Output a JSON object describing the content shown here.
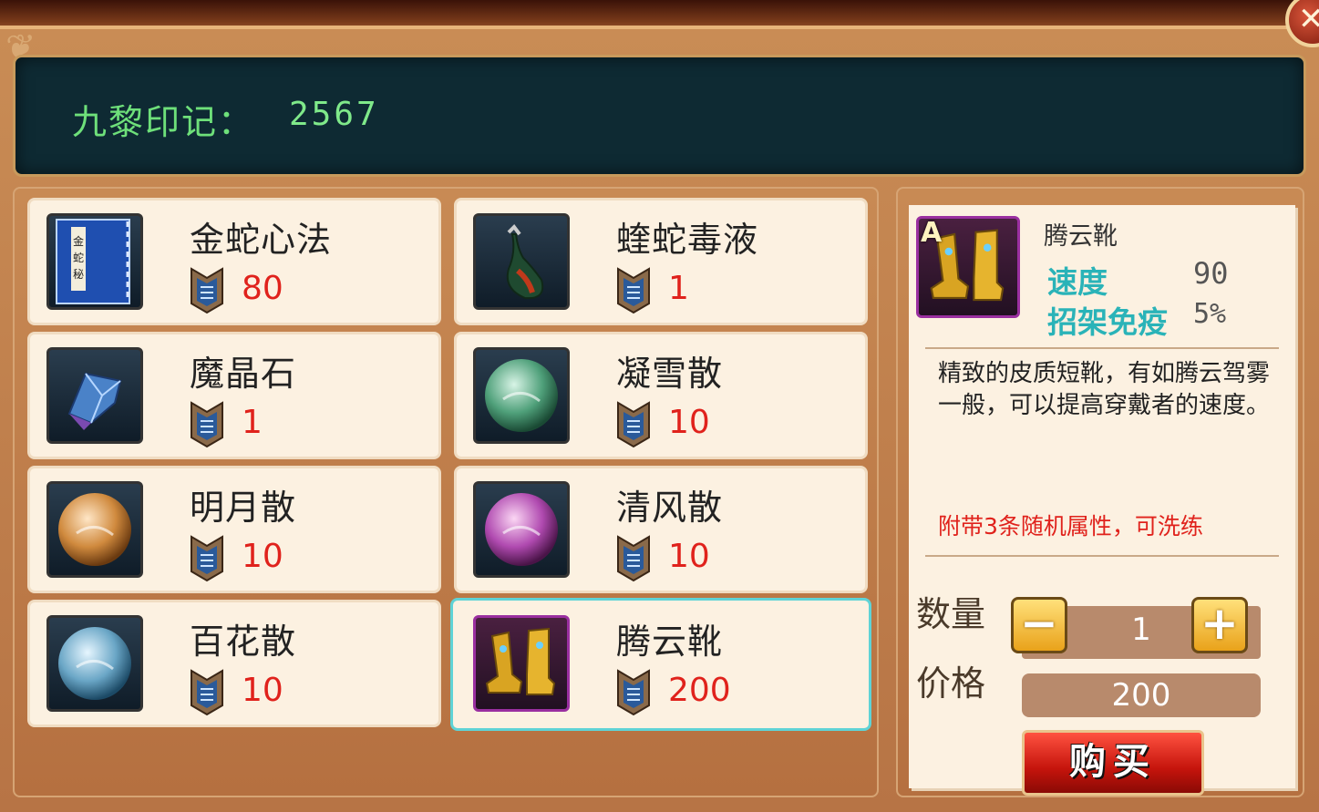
{
  "currency": {
    "label": "九黎印记：",
    "value": "2567"
  },
  "items": [
    {
      "name": "金蛇心法",
      "price": "80"
    },
    {
      "name": "蝰蛇毒液",
      "price": "1"
    },
    {
      "name": "魔晶石",
      "price": "1"
    },
    {
      "name": "凝雪散",
      "price": "10"
    },
    {
      "name": "明月散",
      "price": "10"
    },
    {
      "name": "清风散",
      "price": "10"
    },
    {
      "name": "百花散",
      "price": "10"
    },
    {
      "name": "腾云靴",
      "price": "200"
    }
  ],
  "icons": [
    "book-icon",
    "venom-gourd-icon",
    "magic-crystal-icon",
    "green-pearl-icon",
    "orange-pearl-icon",
    "purple-pearl-icon",
    "blue-pearl-icon",
    "boots-icon"
  ],
  "selected_index": 7,
  "detail": {
    "grade": "A",
    "name": "腾云靴",
    "stats": [
      {
        "name": "速度",
        "value": "90"
      },
      {
        "name": "招架免疫",
        "value": "5%"
      }
    ],
    "description": "精致的皮质短靴，有如腾云驾雾一般，可以提高穿戴者的速度。",
    "note": "附带3条随机属性，可洗练",
    "quantity_label": "数量",
    "quantity": "1",
    "minus_label": "−",
    "plus_label": "+",
    "price_label": "价格",
    "price": "200",
    "buy_label": "购买"
  },
  "close_label": "✕",
  "colors": {
    "price_red": "#e0221c",
    "currency_green": "#6ee07a",
    "stat_cyan": "#2ab3b8",
    "selected_border": "#5fd3d6"
  }
}
